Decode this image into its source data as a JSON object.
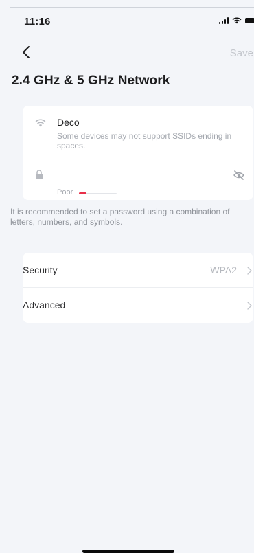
{
  "status_bar": {
    "time": "11:16"
  },
  "nav": {
    "save_label": "Save"
  },
  "page": {
    "title": "2.4 GHz & 5 GHz Network"
  },
  "network": {
    "ssid": "Deco",
    "ssid_note": "Some devices may not support SSIDs ending in spaces.",
    "password_strength_label": "Poor",
    "password_strength_fraction": 0.2
  },
  "hint": "It is recommended to set a password using a combination of letters, numbers, and symbols.",
  "settings": {
    "security_label": "Security",
    "security_value": "WPA2",
    "advanced_label": "Advanced"
  },
  "colors": {
    "background": "#f3f5f9",
    "card": "#ffffff",
    "strength_poor": "#e8304a",
    "muted_text": "#a4a8af"
  },
  "icons": [
    "back-chevron-icon",
    "wifi-icon",
    "lock-icon",
    "eye-off-icon",
    "chevron-right-icon",
    "signal-icon",
    "battery-icon"
  ]
}
